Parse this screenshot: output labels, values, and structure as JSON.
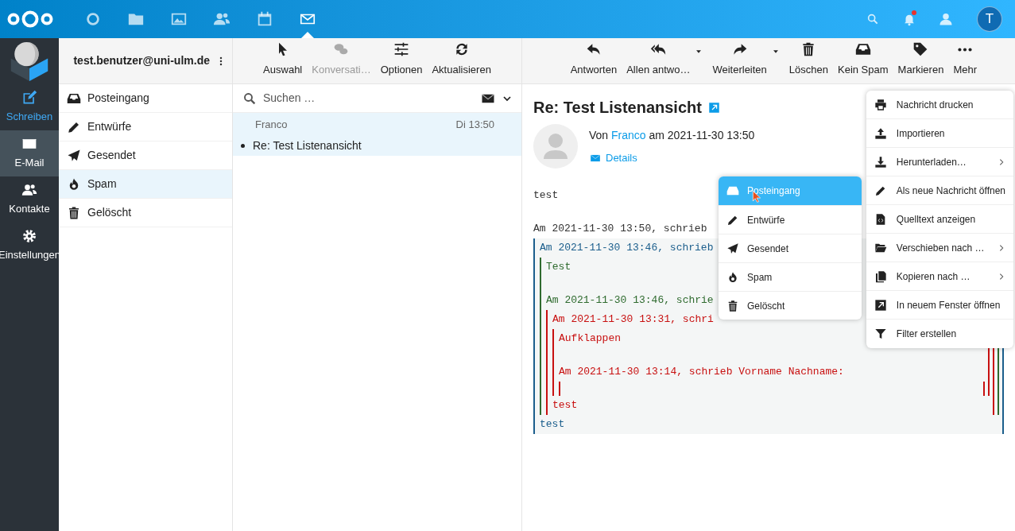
{
  "top_nav": {
    "apps": [
      {
        "selected": false
      },
      {
        "selected": false
      },
      {
        "selected": false
      },
      {
        "selected": false
      },
      {
        "selected": false
      },
      {
        "selected": true
      }
    ],
    "notification_dot": true,
    "avatar": "T"
  },
  "app_rail": [
    {
      "label": "Schreiben",
      "selected": false
    },
    {
      "label": "E-Mail",
      "selected": true
    },
    {
      "label": "Kontakte",
      "selected": false
    },
    {
      "label": "Einstellungen",
      "selected": false
    }
  ],
  "account": {
    "email": "test.benutzer@uni-ulm.de"
  },
  "folders": [
    {
      "label": "Posteingang",
      "selected": false
    },
    {
      "label": "Entwürfe",
      "selected": false
    },
    {
      "label": "Gesendet",
      "selected": false
    },
    {
      "label": "Spam",
      "selected": true
    },
    {
      "label": "Gelöscht",
      "selected": false
    }
  ],
  "list_toolbar": [
    {
      "label": "Auswahl",
      "disabled": false
    },
    {
      "label": "Konversati…",
      "disabled": true
    },
    {
      "label": "Optionen",
      "disabled": false
    },
    {
      "label": "Aktualisieren",
      "disabled": false
    }
  ],
  "search": {
    "placeholder": "Suchen …"
  },
  "messages": [
    {
      "sender": "Franco",
      "date": "Di 13:50",
      "subject": "Re: Test Listenansicht",
      "selected": true,
      "unread": true
    }
  ],
  "reader_toolbar": [
    {
      "label": "Antworten",
      "dropdown": false
    },
    {
      "label": "Allen antwo…",
      "dropdown": true
    },
    {
      "label": "Weiterleiten",
      "dropdown": true
    },
    {
      "label": "Löschen",
      "dropdown": false
    },
    {
      "label": "Kein Spam",
      "dropdown": false
    },
    {
      "label": "Markieren",
      "dropdown": false
    },
    {
      "label": "Mehr",
      "dropdown": false
    }
  ],
  "message": {
    "subject": "Re: Test Listenansicht",
    "from_prefix": "Von",
    "from": "Franco",
    "date_text": "am 2021-11-30 13:50",
    "details_link": "Details",
    "body": [
      {
        "kind": "text",
        "text": "test"
      },
      {
        "kind": "gap"
      },
      {
        "kind": "text",
        "text": "Am 2021-11-30 13:50, schrieb"
      },
      {
        "kind": "quote",
        "color": "#1b5e8c",
        "children": [
          {
            "kind": "text",
            "text": "Am 2021-11-30 13:46, schrieb"
          },
          {
            "kind": "quote",
            "color": "#2f6b2f",
            "children": [
              {
                "kind": "text",
                "text": "Test"
              },
              {
                "kind": "gap"
              },
              {
                "kind": "text",
                "text": "Am 2021-11-30 13:46, schrie"
              },
              {
                "kind": "quote",
                "color": "#c81010",
                "children": [
                  {
                    "kind": "text",
                    "text": "Am 2021-11-30 13:31, schri"
                  },
                  {
                    "kind": "quote",
                    "color": "#c81010",
                    "children": [
                      {
                        "kind": "text",
                        "text": "Aufklappen"
                      },
                      {
                        "kind": "gap"
                      },
                      {
                        "kind": "text",
                        "text": "Am 2021-11-30 13:14, schrieb Vorname Nachname:"
                      },
                      {
                        "kind": "quote",
                        "color": "#c81010",
                        "children": [
                          {
                            "kind": "gap"
                          }
                        ]
                      }
                    ]
                  },
                  {
                    "kind": "text",
                    "text": "test"
                  }
                ]
              }
            ]
          },
          {
            "kind": "text",
            "text": "test"
          }
        ]
      }
    ]
  },
  "more_menu": [
    {
      "label": "Nachricht drucken",
      "submenu": false
    },
    {
      "label": "Importieren",
      "submenu": false
    },
    {
      "label": "Herunterladen…",
      "submenu": true
    },
    {
      "label": "Als neue Nachricht öffnen",
      "submenu": false
    },
    {
      "label": "Quelltext anzeigen",
      "submenu": false
    },
    {
      "label": "Verschieben nach …",
      "submenu": true
    },
    {
      "label": "Kopieren nach …",
      "submenu": true
    },
    {
      "label": "In neuem Fenster öffnen",
      "submenu": false
    },
    {
      "label": "Filter erstellen",
      "submenu": false
    }
  ],
  "move_submenu": [
    {
      "label": "Posteingang",
      "selected": true
    },
    {
      "label": "Entwürfe",
      "selected": false
    },
    {
      "label": "Gesendet",
      "selected": false
    },
    {
      "label": "Spam",
      "selected": false
    },
    {
      "label": "Gelöscht",
      "selected": false
    }
  ]
}
